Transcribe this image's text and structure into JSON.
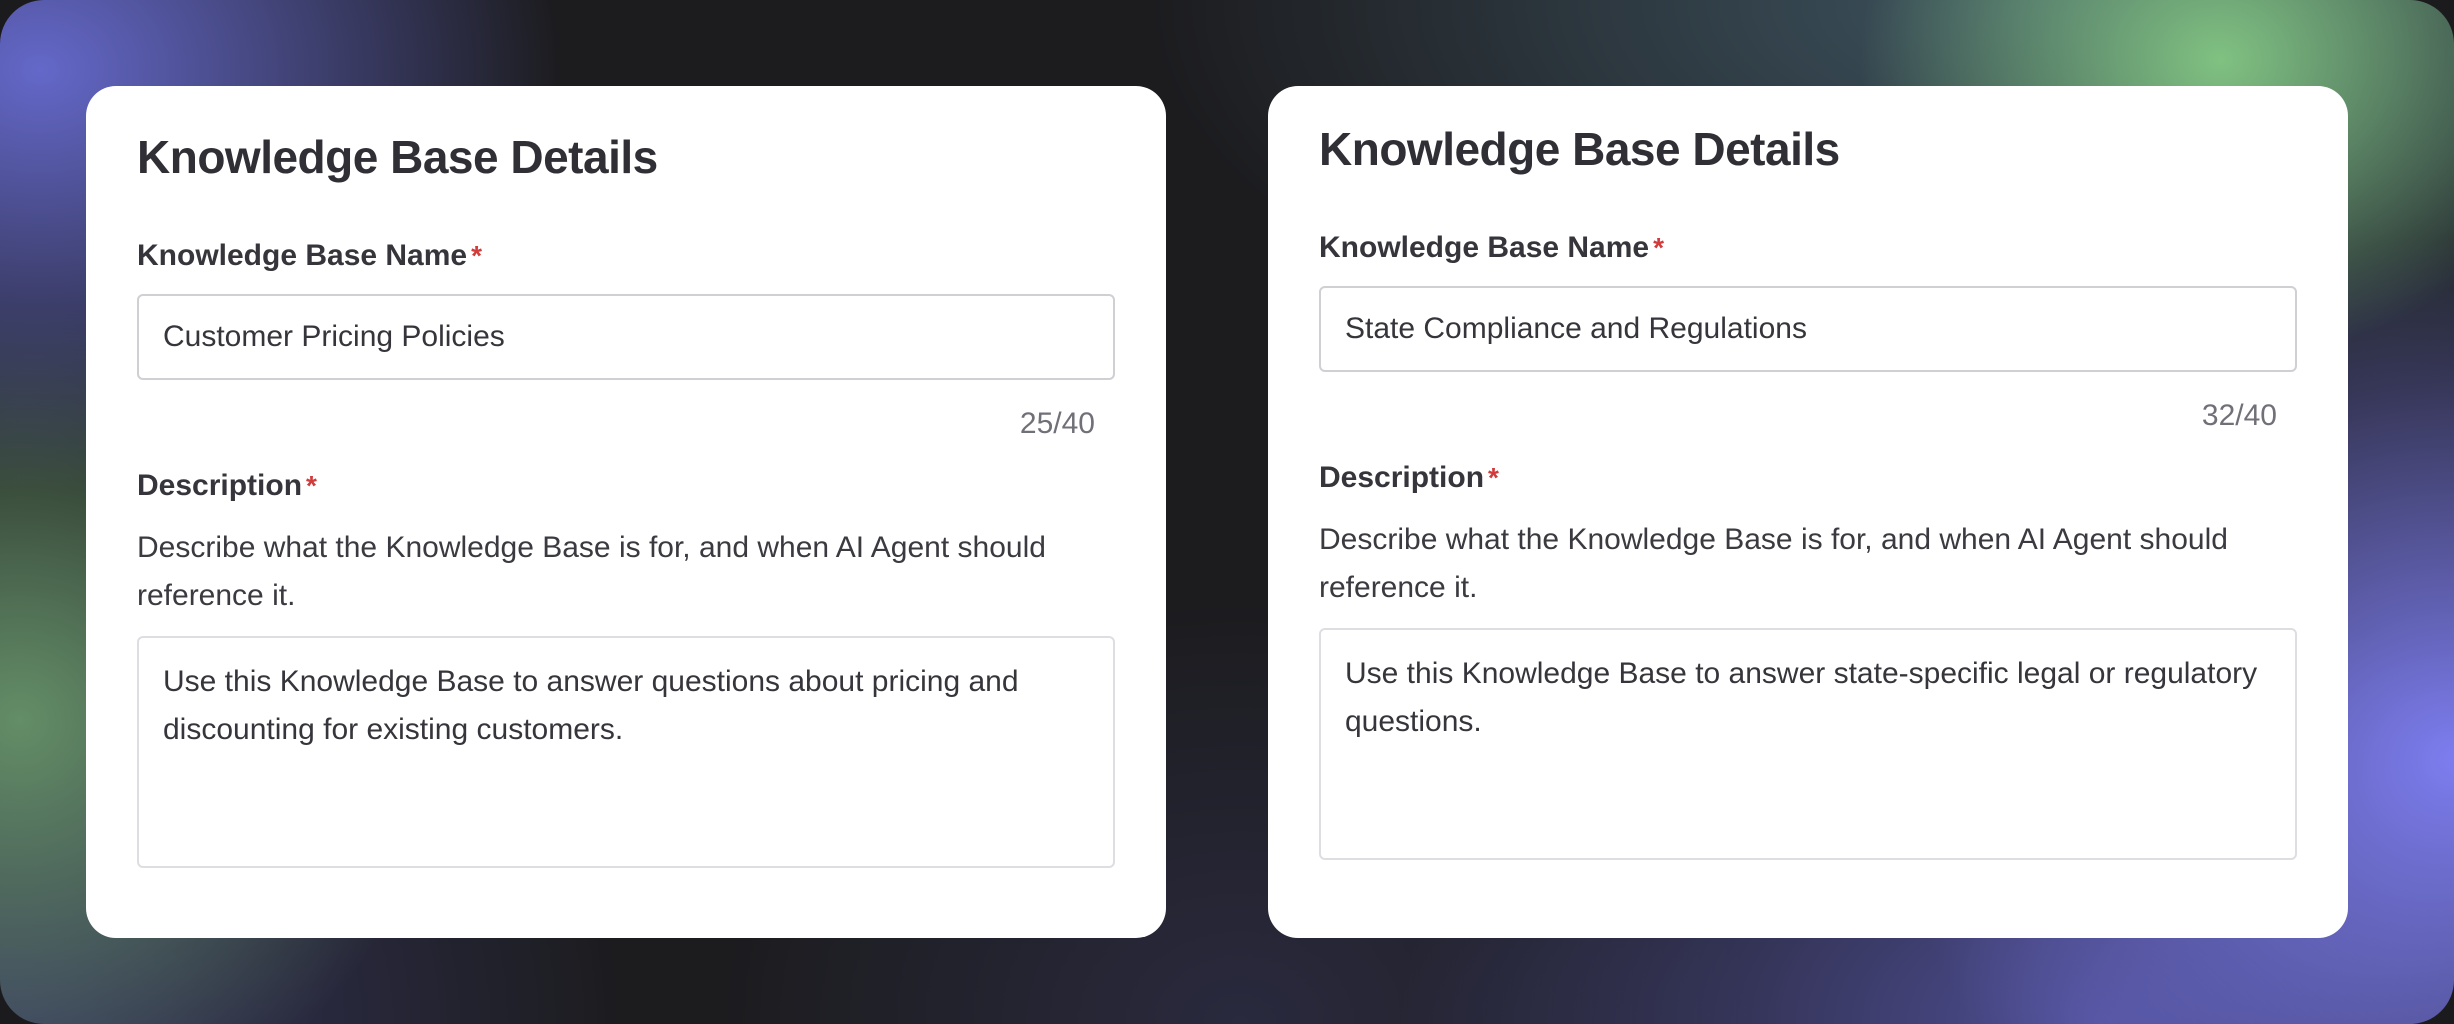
{
  "cards": [
    {
      "title": "Knowledge Base Details",
      "name_label": "Knowledge Base Name",
      "required_mark": "*",
      "name_value": "Customer Pricing Policies",
      "char_count": "25/40",
      "description_label": "Description",
      "description_helper": "Describe what the Knowledge Base is for, and when AI Agent should reference it.",
      "description_value": "Use this Knowledge Base to answer questions about pricing and discounting for existing customers."
    },
    {
      "title": "Knowledge Base Details",
      "name_label": "Knowledge Base Name",
      "required_mark": "*",
      "name_value": "State Compliance and Regulations",
      "char_count": "32/40",
      "description_label": "Description",
      "description_helper": "Describe what the Knowledge Base is for, and when AI Agent should reference it.",
      "description_value": "Use this Knowledge Base to answer state-specific legal or regulatory questions."
    }
  ],
  "colors": {
    "card_background": "#ffffff",
    "required_star": "#d23b3b",
    "input_border": "#cfcfd4",
    "text_primary": "#2f2f35",
    "text_muted": "#707078"
  }
}
